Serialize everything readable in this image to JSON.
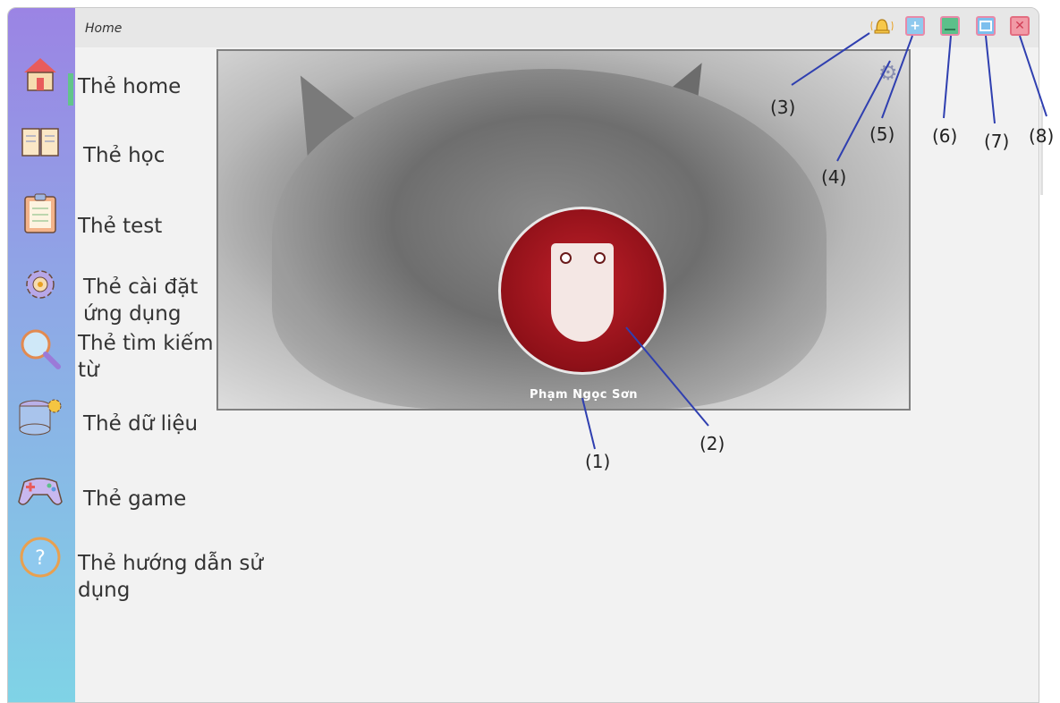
{
  "window": {
    "title": "Home"
  },
  "title_controls": [
    {
      "name": "notification-bell-icon"
    },
    {
      "name": "add-icon"
    },
    {
      "name": "minimize-icon"
    },
    {
      "name": "maximize-icon"
    },
    {
      "name": "close-icon"
    }
  ],
  "sidebar": {
    "items": [
      {
        "label": "Thẻ home",
        "icon": "home-icon"
      },
      {
        "label": "Thẻ học",
        "icon": "book-icon"
      },
      {
        "label": "Thẻ test",
        "icon": "clipboard-icon"
      },
      {
        "label": "Thẻ cài đặt\nứng dụng",
        "icon": "gear-icon"
      },
      {
        "label": "Thẻ tìm kiếm\ntừ",
        "icon": "magnifier-icon"
      },
      {
        "label": "Thẻ dữ liệu",
        "icon": "database-icon"
      },
      {
        "label": "Thẻ game",
        "icon": "gamepad-icon"
      },
      {
        "label": "Thẻ hướng dẫn sử\ndụng",
        "icon": "help-icon"
      }
    ]
  },
  "profile": {
    "name": "Phạm Ngọc Sơn"
  },
  "annotations": {
    "labels": [
      "(1)",
      "(2)",
      "(3)",
      "(4)",
      "(5)",
      "(6)",
      "(7)",
      "(8)"
    ]
  },
  "colors": {
    "sidebar_top": "#9b84e4",
    "sidebar_bottom": "#7fd3e6",
    "active_indicator": "#62c58a",
    "annotation_line": "#2f3fb0"
  }
}
